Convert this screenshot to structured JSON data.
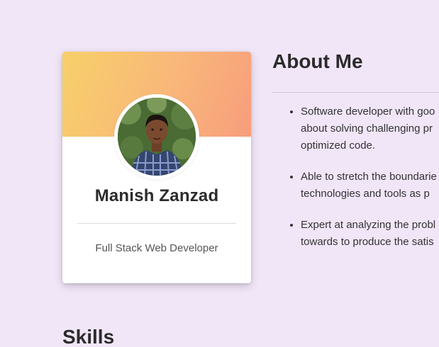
{
  "profile": {
    "name": "Manish Zanzad",
    "role": "Full Stack Web Developer",
    "avatar_icon": "profile-photo",
    "banner_colors": [
      "#f7d06a",
      "#f79d7c"
    ]
  },
  "about": {
    "title": "About Me",
    "items": [
      {
        "lines": [
          "Software developer with goo",
          "about solving challenging pr",
          "optimized code."
        ]
      },
      {
        "lines": [
          "Able to stretch the boundarie",
          "technologies and tools as p"
        ]
      },
      {
        "lines": [
          "Expert at analyzing the probl",
          "towards to produce the satis"
        ]
      }
    ]
  },
  "skills": {
    "title": "Skills"
  },
  "colors": {
    "background": "#f1e6f8",
    "card": "#ffffff",
    "text": "#2b2b2b"
  }
}
